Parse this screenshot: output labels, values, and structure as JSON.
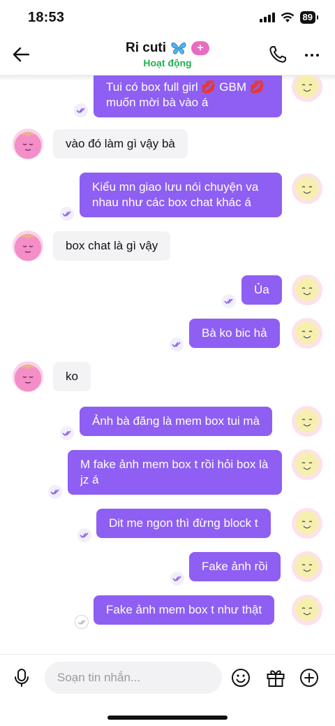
{
  "status_bar": {
    "time": "18:53",
    "battery": "89",
    "icons": [
      "signal-icon",
      "wifi-icon",
      "battery-icon"
    ]
  },
  "header": {
    "contact_name": "Ri cuti",
    "name_emoji": "butterfly-icon",
    "plus_badge": "+",
    "presence": "Hoạt động",
    "icons": [
      "back-arrow-icon",
      "phone-icon",
      "more-icon"
    ]
  },
  "colors": {
    "outgoing_bubble": "#8e5ff2",
    "incoming_bubble": "#f3f3f5",
    "presence_green": "#22b04d",
    "plus_badge": "#e86cc1"
  },
  "messages": [
    {
      "from": "me",
      "text": "Tui có box full girl 💋 GBM 💋 muốn mời bà vào á"
    },
    {
      "from": "them",
      "text": "vào đó làm gì vậy bà"
    },
    {
      "from": "me",
      "text": "Kiểu mn giao lưu nói chuyện va nhau như các box chat khác á"
    },
    {
      "from": "them",
      "text": "box chat là gì vậy"
    },
    {
      "from": "me",
      "text": "Ủa"
    },
    {
      "from": "me",
      "text": "Bà ko bic hả"
    },
    {
      "from": "them",
      "text": "ko"
    },
    {
      "from": "me",
      "text": "Ảnh bà đăng là mem box tui mà"
    },
    {
      "from": "me",
      "text": "M fake ảnh mem box t rồi hỏi box là jz á"
    },
    {
      "from": "me",
      "text": "Dit me ngon thì đừng block t"
    },
    {
      "from": "me",
      "text": "Fake ảnh rồi"
    },
    {
      "from": "me",
      "text": "Fake ảnh mem box t như thật"
    }
  ],
  "composer": {
    "placeholder": "Soạn tin nhắn...",
    "icons": [
      "microphone-icon",
      "emoji-icon",
      "gift-icon",
      "add-icon"
    ]
  }
}
